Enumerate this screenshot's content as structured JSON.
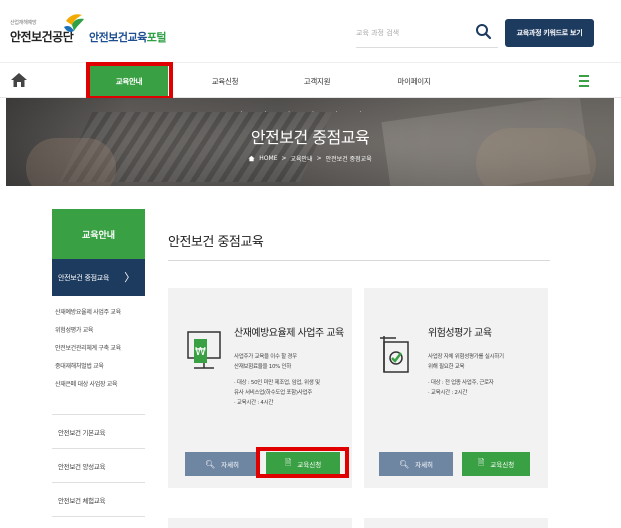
{
  "header": {
    "org_small": "산업재해예방",
    "org_name": "안전보건공단",
    "portal_name_main": "안전보건교육",
    "portal_name_accent": "포털",
    "search_placeholder": "교육 과정 검색",
    "keyword_button": "교육과정 키워드로 보기"
  },
  "gnb": {
    "items": [
      "교육안내",
      "교육신청",
      "고객지원",
      "마이페이지"
    ],
    "active_index": 0
  },
  "banner": {
    "dots": "· · · · · ·",
    "title": "안전보건 중점교육",
    "breadcrumb": [
      "HOME",
      "교육안내",
      "안전보건 중점교육"
    ]
  },
  "sidebar": {
    "heading": "교육안내",
    "active_item": "안전보건 중점교육",
    "sub_items": [
      "산재예방요율제 사업주 교육",
      "위험성평가 교육",
      "안전보건관리체계 구축 교육",
      "중대재해처벌법 교육",
      "산재은폐 대상 사업장 교육"
    ],
    "main_items": [
      "안전보건 기본교육",
      "안전보건 양성교육",
      "안전보건 체험교육"
    ]
  },
  "content": {
    "page_title": "안전보건 중점교육",
    "cards": [
      {
        "title": "산재예방요율제 사업주 교육",
        "desc": [
          "사업주가 교육을 이수 할 경우",
          "산재보험료율을 10% 인하",
          "",
          "· 대상 : 50인 미만 제조업, 임업, 위생 및",
          "  유사 서비스업(하수도업 포함)사업주",
          "· 교육시간 : 4시간"
        ],
        "detail_label": "자세히",
        "apply_label": "교육신청"
      },
      {
        "title": "위험성평가 교육",
        "desc": [
          "사업장 자체 위험성평가를 실시하기",
          "위해 필요한 교육",
          "",
          "· 대상 : 전 업종 사업주, 근로자",
          "· 교육시간 : 2시간"
        ],
        "detail_label": "자세히",
        "apply_label": "교육신청"
      }
    ]
  },
  "colors": {
    "green": "#3aa044",
    "navy": "#1d3a5f",
    "detail_button": "#6f86a3",
    "highlight": "#e00000"
  }
}
